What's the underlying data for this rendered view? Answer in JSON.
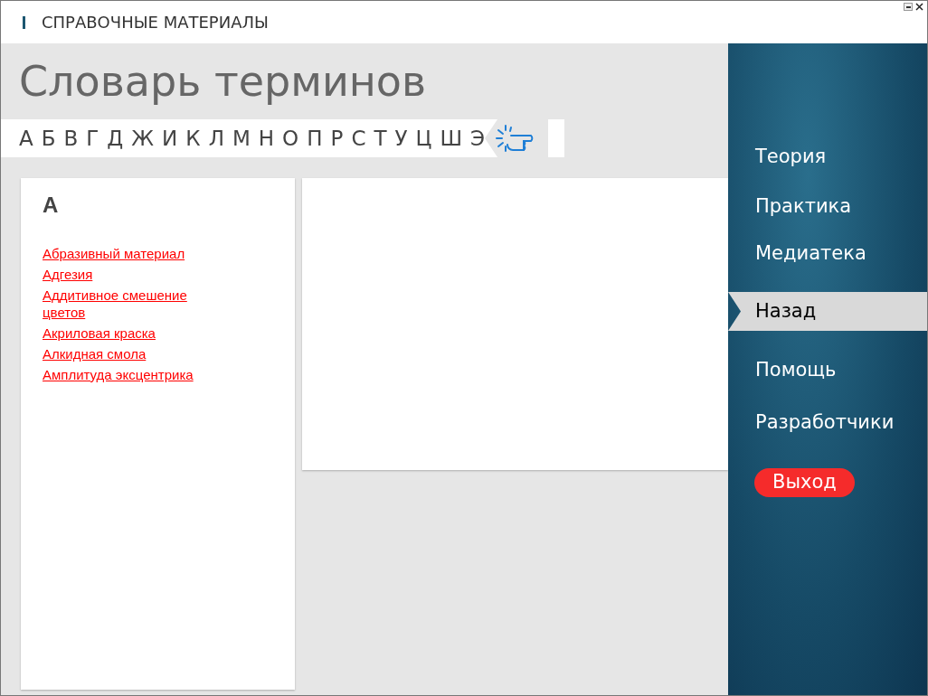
{
  "header": {
    "title": "СПРАВОЧНЫЕ МАТЕРИАЛЫ"
  },
  "page": {
    "title": "Словарь терминов"
  },
  "alphabet": [
    "А",
    "Б",
    "В",
    "Г",
    "Д",
    "Ж",
    "И",
    "К",
    "Л",
    "М",
    "Н",
    "О",
    "П",
    "Р",
    "С",
    "Т",
    "У",
    "Ц",
    "Ш",
    "Э"
  ],
  "terms": {
    "letter": "А",
    "items": [
      "Абразивный материал",
      "Адгезия",
      "Аддитивное смешение цветов",
      "Акриловая краска",
      "Алкидная смола",
      "Амплитуда эксцентрика"
    ]
  },
  "nav": [
    {
      "label": "Теория",
      "kind": "link",
      "selected": false
    },
    {
      "label": "Практика",
      "kind": "link",
      "selected": false
    },
    {
      "label": "Медиатека",
      "kind": "link",
      "selected": false
    },
    {
      "label": "Назад",
      "kind": "link",
      "selected": true
    },
    {
      "label": "Помощь",
      "kind": "link",
      "selected": false
    },
    {
      "label": "Разработчики",
      "kind": "link",
      "selected": false
    },
    {
      "label": "Выход",
      "kind": "exit",
      "selected": false
    }
  ]
}
